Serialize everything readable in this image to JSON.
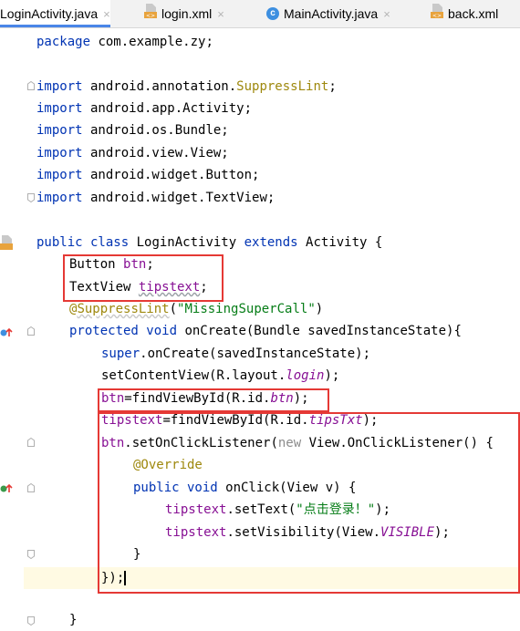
{
  "tabs": [
    {
      "label": "LoginActivity.java",
      "icon": "java-class-icon",
      "active": true
    },
    {
      "label": "login.xml",
      "icon": "xml-file-icon"
    },
    {
      "label": "MainActivity.java",
      "icon": "java-class-icon"
    },
    {
      "label": "back.xml",
      "icon": "xml-file-icon"
    }
  ],
  "tab_close": "×",
  "code": {
    "l1_kw": "package",
    "l1_rest": " com.example.zy;",
    "l3_kw": "import",
    "l3_pkg": " android.annotation.",
    "l3_cls": "SuppressLint",
    "l3_end": ";",
    "l4_kw": "import",
    "l4_rest": " android.app.Activity;",
    "l5_kw": "import",
    "l5_rest": " android.os.Bundle;",
    "l6_kw": "import",
    "l6_rest": " android.view.View;",
    "l7_kw": "import",
    "l7_rest": " android.widget.Button;",
    "l8_kw": "import",
    "l8_rest": " android.widget.TextView;",
    "l10_kw1": "public class",
    "l10_name": " LoginActivity ",
    "l10_kw2": "extends",
    "l10_rest": " Activity {",
    "l11_type": "Button ",
    "l11_var": "btn",
    "l11_end": ";",
    "l12_type": "TextView ",
    "l12_var": "tipstext",
    "l12_end": ";",
    "l13_at": "@",
    "l13_ann": "SuppressLint",
    "l13_open": "(",
    "l13_str": "\"MissingSuperCall\"",
    "l13_close": ")",
    "l14_kw": "protected void",
    "l14_rest": " onCreate(Bundle savedInstanceState){",
    "l15_kw": "super",
    "l15_rest": ".onCreate(savedInstanceState);",
    "l16_pre": "setContentView(R.layout.",
    "l16_it": "login",
    "l16_post": ");",
    "l17_var": "btn",
    "l17_mid": "=findViewById(R.id.",
    "l17_it": "btn",
    "l17_post": ");",
    "l18_var": "tipstext",
    "l18_mid": "=findViewById(R.id.",
    "l18_it": "tipsTxt",
    "l18_post": ");",
    "l19_var": "btn",
    "l19_mid": ".setOnClickListener(",
    "l19_new": "new",
    "l19_post": " View.OnClickListener() {",
    "l20_ann": "@Override",
    "l21_kw": "public void",
    "l21_rest": " onClick(View v) {",
    "l22_var": "tipstext",
    "l22_mid": ".setText(",
    "l22_str": "\"点击登录！\"",
    "l22_post": ");",
    "l23_var": "tipstext",
    "l23_mid": ".setVisibility(View.",
    "l23_it": "VISIBLE",
    "l23_post": ");",
    "l24": "}",
    "l25": "});",
    "l27": "}"
  },
  "colors": {
    "keyword": "#0033b3",
    "field": "#871094",
    "string": "#067d17",
    "annotation": "#9e880d",
    "highlight_box": "#e53935",
    "current_line": "#fffae3"
  }
}
